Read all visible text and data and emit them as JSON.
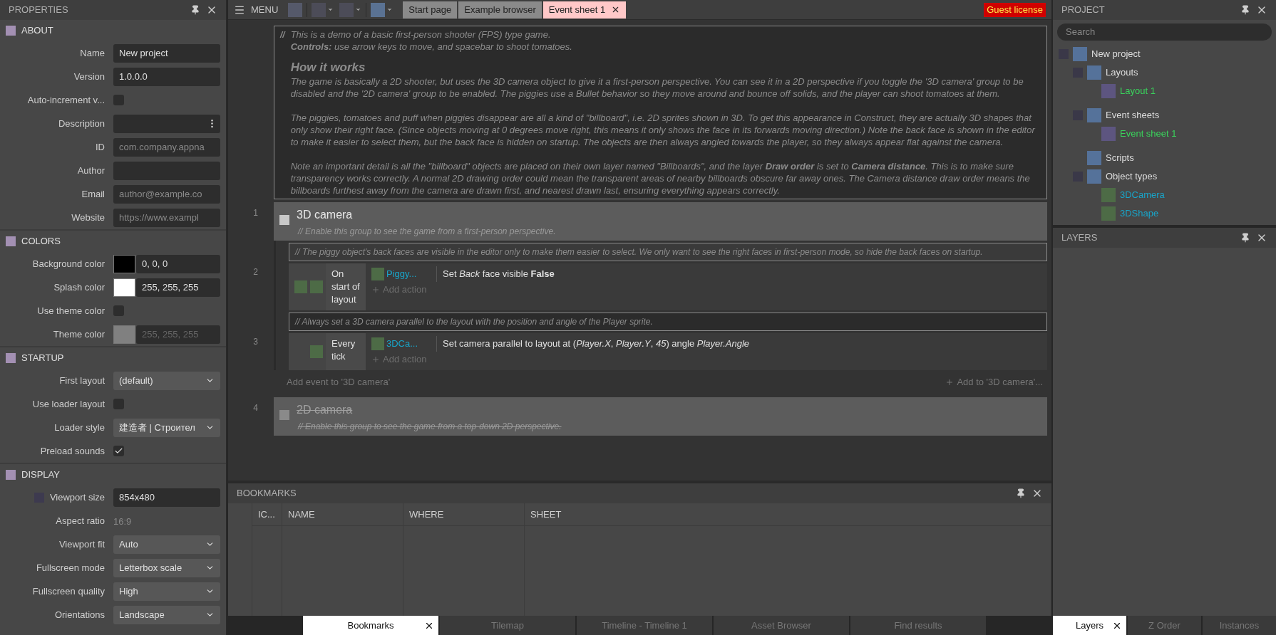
{
  "properties": {
    "title": "PROPERTIES",
    "sections": [
      {
        "title": "ABOUT",
        "rows": [
          {
            "kind": "text",
            "label": "Name",
            "value": "New project"
          },
          {
            "kind": "text",
            "label": "Version",
            "value": "1.0.0.0"
          },
          {
            "kind": "check",
            "label": "Auto-increment v...",
            "checked": false
          },
          {
            "kind": "dots",
            "label": "Description"
          },
          {
            "kind": "text",
            "label": "ID",
            "placeholder": "com.company.appna"
          },
          {
            "kind": "text",
            "label": "Author"
          },
          {
            "kind": "text",
            "label": "Email",
            "placeholder": "author@example.co"
          },
          {
            "kind": "text",
            "label": "Website",
            "placeholder": "https://www.exampl"
          }
        ]
      },
      {
        "title": "COLORS",
        "rows": [
          {
            "kind": "color",
            "label": "Background color",
            "value": "0, 0, 0",
            "color": "#000000",
            "disabled": false
          },
          {
            "kind": "color",
            "label": "Splash color",
            "value": "255, 255, 255",
            "color": "#ffffff",
            "disabled": false
          },
          {
            "kind": "check",
            "label": "Use theme color",
            "checked": false
          },
          {
            "kind": "color",
            "label": "Theme color",
            "value": "255, 255, 255",
            "color": "#808080",
            "disabled": true
          }
        ]
      },
      {
        "title": "STARTUP",
        "rows": [
          {
            "kind": "select",
            "label": "First layout",
            "value": "(default)"
          },
          {
            "kind": "check",
            "label": "Use loader layout",
            "checked": false
          },
          {
            "kind": "select",
            "label": "Loader style",
            "value": "建造者 | Строител"
          },
          {
            "kind": "check",
            "label": "Preload sounds",
            "checked": true
          }
        ]
      },
      {
        "title": "DISPLAY",
        "rows": [
          {
            "kind": "text",
            "label": "Viewport size",
            "value": "854x480",
            "icon": true
          },
          {
            "kind": "readonly",
            "label": "Aspect ratio",
            "value": "16:9"
          },
          {
            "kind": "select",
            "label": "Viewport fit",
            "value": "Auto"
          },
          {
            "kind": "select",
            "label": "Fullscreen mode",
            "value": "Letterbox scale"
          },
          {
            "kind": "select",
            "label": "Fullscreen quality",
            "value": "High"
          },
          {
            "kind": "select",
            "label": "Orientations",
            "value": "Landscape"
          }
        ]
      }
    ]
  },
  "toolbar": {
    "menu": "MENU",
    "tabs": [
      {
        "label": "Start page",
        "selected": false
      },
      {
        "label": "Example browser",
        "selected": false
      },
      {
        "label": "Event sheet 1",
        "selected": true
      }
    ],
    "license": "Guest license"
  },
  "event_sheet": {
    "intro": {
      "marker": "//",
      "lines": [
        "This is a demo of a basic first-person shooter (FPS) type game.",
        "**Controls:** use arrow keys to move, and spacebar to shoot tomatoes."
      ],
      "heading": "How it works",
      "paragraphs": [
        "The game is basically a 2D shooter, but uses the 3D camera object to give it a first-person perspective. You can see it in a 2D perspective if you toggle the '3D camera' group to be disabled and the '2D camera' group to be enabled. The piggies use a Bullet behavior so they move around and bounce off solids, and the player can shoot tomatoes at them.",
        "The piggies, tomatoes and puff when piggies disappear are all a kind of \"billboard\", i.e. 2D sprites shown in 3D. To get this appearance in Construct, they are actually 3D shapes that only show their right face. (Since objects moving at 0 degrees move right, this means it only shows the face in its forwards moving direction.) Note the back face is shown in the editor to make it easier to select them, but the back face is hidden on startup. The objects are then always angled towards the player, so they always appear flat against the camera.",
        "Note an important detail is all the \"billboard\" objects are placed on their own layer named \"Billboards\", and the layer **Draw order** is set to **Camera distance**. This is to make sure transparency works correctly. A normal 2D drawing order could mean the transparent areas of nearby billboards obscure far away ones. The  Camera distance  draw order means the billboards furthest away from the camera are drawn first, and nearest drawn last, ensuring everything appears correctly."
      ]
    },
    "groups": [
      {
        "number": "1",
        "title": "3D camera",
        "enabled": true,
        "comment": "// Enable this group to see the game from a first-person perspective.",
        "children": [
          {
            "kind": "comment",
            "text": "// The piggy object's back faces are visible in the editor only to make them easier to select. We only want to see the right faces in first-person mode, so hide the back faces on startup."
          },
          {
            "kind": "event",
            "number": "2",
            "condition": {
              "kind": "trigger",
              "text": "On start of layout"
            },
            "actions": [
              {
                "object": "Piggy...",
                "text": "Set *Back* face visible **False**"
              }
            ],
            "add_action": "Add action"
          },
          {
            "kind": "comment",
            "text": "// Always set a 3D camera parallel to the layout with the position and angle of the Player sprite."
          },
          {
            "kind": "event",
            "number": "3",
            "condition": {
              "kind": "plain",
              "text": "Every tick"
            },
            "actions": [
              {
                "object": "3DCa...",
                "text": "Set camera parallel to layout at (*Player.X*, *Player.Y*, *45*) angle *Player.Angle*"
              }
            ],
            "add_action": "Add action"
          }
        ],
        "add_event": "Add event to '3D camera'",
        "add_to": "Add to '3D camera'..."
      },
      {
        "number": "4",
        "title": "2D camera",
        "enabled": false,
        "comment": "// Enable this group to see the game from a top-down 2D perspective."
      }
    ]
  },
  "bookmarks": {
    "title": "BOOKMARKS",
    "columns": [
      "IC...",
      "NAME",
      "WHERE",
      "SHEET"
    ]
  },
  "bottom_tabs": [
    {
      "label": "Bookmarks",
      "selected": true
    },
    {
      "label": "Tilemap",
      "selected": false
    },
    {
      "label": "Timeline - Timeline 1",
      "selected": false
    },
    {
      "label": "Asset Browser",
      "selected": false
    },
    {
      "label": "Find results",
      "selected": false
    }
  ],
  "project": {
    "title": "PROJECT",
    "search": {
      "placeholder": "Search"
    },
    "tree": [
      {
        "kind": "folder",
        "label": "New project",
        "children": [
          {
            "kind": "folder",
            "label": "Layouts",
            "children": [
              {
                "kind": "layout",
                "label": "Layout 1"
              }
            ]
          },
          {
            "kind": "folder",
            "label": "Event sheets",
            "children": [
              {
                "kind": "layout",
                "label": "Event sheet 1"
              }
            ]
          },
          {
            "kind": "folder",
            "label": "Scripts"
          },
          {
            "kind": "folder",
            "label": "Object types",
            "children": [
              {
                "kind": "object",
                "label": "3DCamera"
              },
              {
                "kind": "object",
                "label": "3DShape"
              }
            ]
          }
        ]
      }
    ]
  },
  "layers": {
    "title": "LAYERS"
  },
  "right_tabs": [
    {
      "label": "Layers",
      "selected": true
    },
    {
      "label": "Z Order",
      "selected": false
    },
    {
      "label": "Instances",
      "selected": false
    }
  ]
}
